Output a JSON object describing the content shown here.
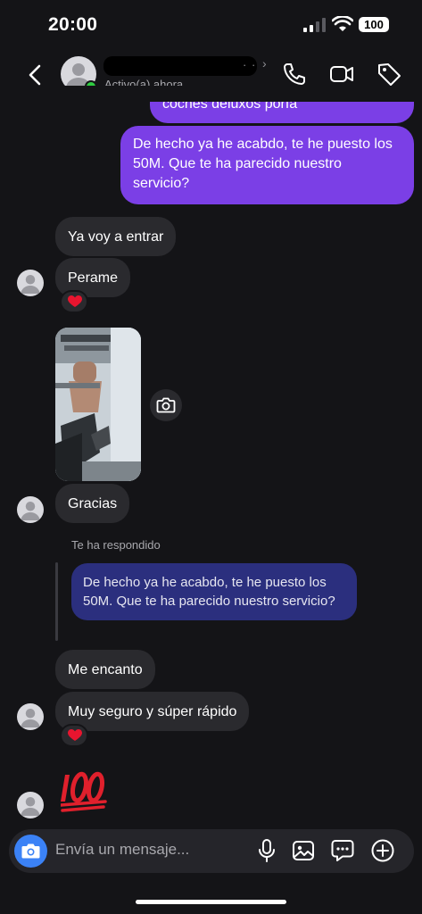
{
  "status_bar": {
    "time": "20:00",
    "battery": "100"
  },
  "header": {
    "status": "Activo(a) ahora",
    "name_redacted_fragment": "·  ·",
    "chevron": "›"
  },
  "messages": {
    "outgoing_1_partial": "coches deluxos porfa",
    "outgoing_2": "De hecho ya he acabdo, te he puesto los 50M. Que te ha parecido nuestro servicio?",
    "incoming_1": "Ya voy a entrar",
    "incoming_2": "Perame",
    "incoming_3": "Gracias",
    "replied_label": "Te ha respondido",
    "quoted_reply": "De hecho ya he acabdo, te he puesto los 50M. Que te ha parecido nuestro servicio?",
    "incoming_4": "Me encanto",
    "incoming_5": "Muy seguro y súper rápido"
  },
  "reactions": {
    "heart": "heart-reaction",
    "hundred": "100-emoji"
  },
  "composer": {
    "placeholder": "Envía un mensaje..."
  },
  "colors": {
    "outgoing_bubble": "#7b3fe6",
    "incoming_bubble": "#2a2a2e",
    "quoted_bubble": "#2b2f7e",
    "online_dot": "#2ecc40",
    "camera_button": "#3b82f6",
    "background": "#141417"
  },
  "icons": [
    "back-arrow-icon",
    "phone-icon",
    "video-camera-icon",
    "tag-icon",
    "camera-icon",
    "microphone-icon",
    "gallery-icon",
    "sticker-chat-icon",
    "plus-circle-icon"
  ]
}
